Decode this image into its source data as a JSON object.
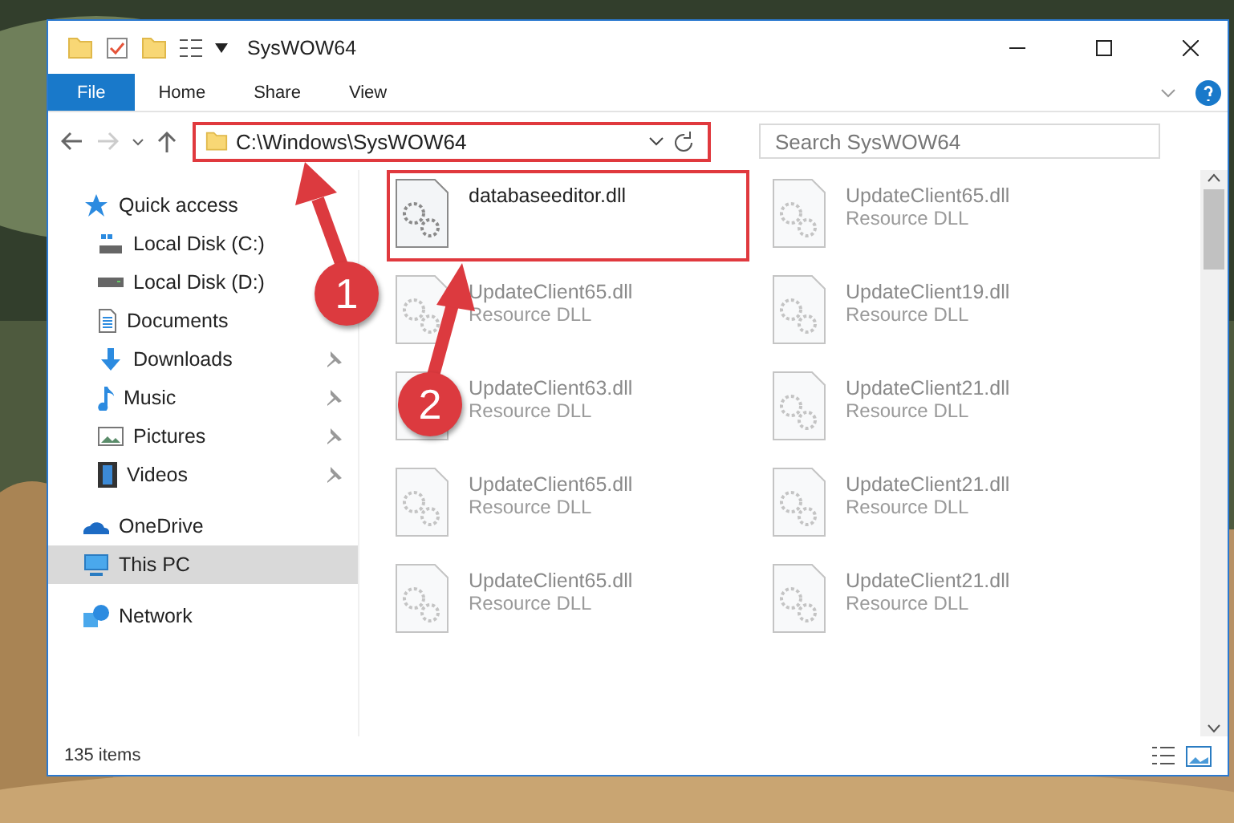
{
  "window": {
    "title": "SysWOW64"
  },
  "ribbon": {
    "tabs": [
      {
        "label": "File",
        "selected": true
      },
      {
        "label": "Home",
        "selected": false
      },
      {
        "label": "Share",
        "selected": false
      },
      {
        "label": "View",
        "selected": false
      }
    ]
  },
  "address_bar": {
    "path": "C:\\Windows\\SysWOW64",
    "highlighted": true
  },
  "search": {
    "placeholder": "Search SysWOW64"
  },
  "sidebar": {
    "items": [
      {
        "kind": "star",
        "label": "Quick access",
        "selected": false,
        "children": [
          {
            "kind": "diskc",
            "label": "Local Disk (C:)",
            "pinned": false
          },
          {
            "kind": "disk",
            "label": "Local Disk (D:)",
            "pinned": false
          },
          {
            "kind": "docs",
            "label": "Documents",
            "pinned": false
          },
          {
            "kind": "download",
            "label": "Downloads",
            "pinned": true
          },
          {
            "kind": "music",
            "label": "Music",
            "pinned": true
          },
          {
            "kind": "pictures",
            "label": "Pictures",
            "pinned": true
          },
          {
            "kind": "videos",
            "label": "Videos",
            "pinned": true
          }
        ]
      },
      {
        "kind": "cloud",
        "label": "OneDrive",
        "selected": false
      },
      {
        "kind": "pc",
        "label": "This PC",
        "selected": true
      },
      {
        "kind": "network",
        "label": "Network",
        "selected": false
      }
    ]
  },
  "files": [
    {
      "name": "databaseeditor.dll",
      "highlighted": true,
      "faded": false
    },
    {
      "name": "UpdateClient65.dll",
      "type": "Resource DLL",
      "highlighted": false,
      "faded": true
    },
    {
      "name": "UpdateClient65.dll",
      "type": "Resource DLL",
      "highlighted": false,
      "faded": true
    },
    {
      "name": "UpdateClient19.dll",
      "type": "Resource DLL",
      "highlighted": false,
      "faded": true
    },
    {
      "name": "UpdateClient63.dll",
      "type": "Resource DLL",
      "highlighted": false,
      "faded": true
    },
    {
      "name": "UpdateClient21.dll",
      "type": "Resource DLL",
      "highlighted": false,
      "faded": true
    },
    {
      "name": "UpdateClient65.dll",
      "type": "Resource DLL",
      "highlighted": false,
      "faded": true
    },
    {
      "name": "UpdateClient21.dll",
      "type": "Resource DLL",
      "highlighted": false,
      "faded": true
    },
    {
      "name": "UpdateClient65.dll",
      "type": "Resource DLL",
      "highlighted": false,
      "faded": true
    },
    {
      "name": "UpdateClient21.dll",
      "type": "Resource DLL",
      "highlighted": false,
      "faded": true
    }
  ],
  "status_bar": {
    "count": "135 items"
  },
  "annotations": [
    {
      "number": "1"
    },
    {
      "number": "2"
    }
  ]
}
